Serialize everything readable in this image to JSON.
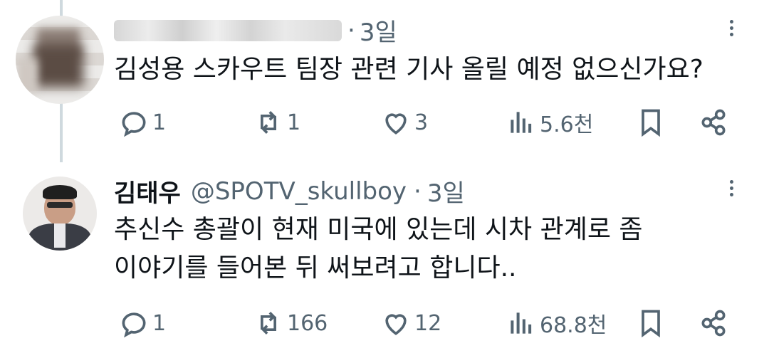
{
  "reply1": {
    "time": "3일",
    "dot": "·",
    "text": "김성용 스카우트 팀장 관련 기사 올릴 예정 없으신가요?",
    "stats": {
      "replies": "1",
      "reposts": "1",
      "likes": "3",
      "views": "5.6천"
    }
  },
  "reply2": {
    "name": "김태우",
    "handle": "@SPOTV_skullboy",
    "dot": "·",
    "time": "3일",
    "text_line1": "추신수 총괄이 현재 미국에 있는데 시차 관계로 좀",
    "text_line2": "이야기를 들어본 뒤 써보려고 합니다..",
    "stats": {
      "replies": "1",
      "reposts": "166",
      "likes": "12",
      "views": "68.8천"
    }
  },
  "icons": [
    "reply-icon",
    "repost-icon",
    "like-icon",
    "views-icon",
    "bookmark-icon",
    "share-icon",
    "more-icon"
  ],
  "colors": {
    "text": "#0f1419",
    "secondary": "#536471",
    "thread": "#cfd9de"
  }
}
